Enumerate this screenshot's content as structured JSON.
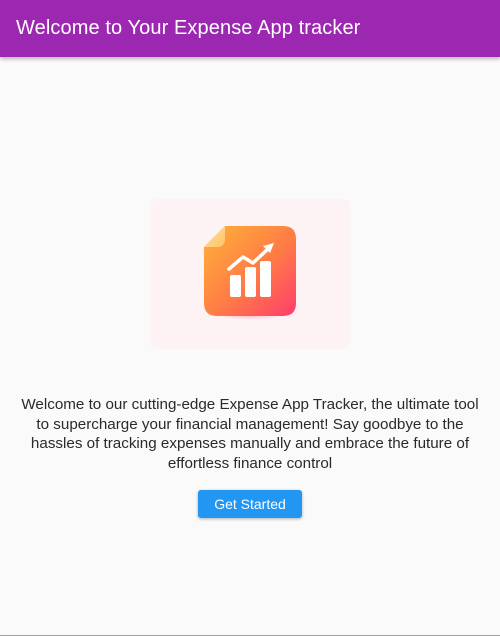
{
  "app_bar": {
    "title": "Welcome to Your Expense App tracker",
    "color": "#9c27b0"
  },
  "hero": {
    "icon": "growth-chart-document-icon",
    "background": "#fdf3f4"
  },
  "main": {
    "description": "Welcome to our cutting-edge Expense App Tracker, the ultimate tool to supercharge your financial management! Say goodbye to the hassles of tracking expenses manually and embrace the future of effortless finance control",
    "cta_label": "Get Started",
    "cta_color": "#2196f3"
  }
}
